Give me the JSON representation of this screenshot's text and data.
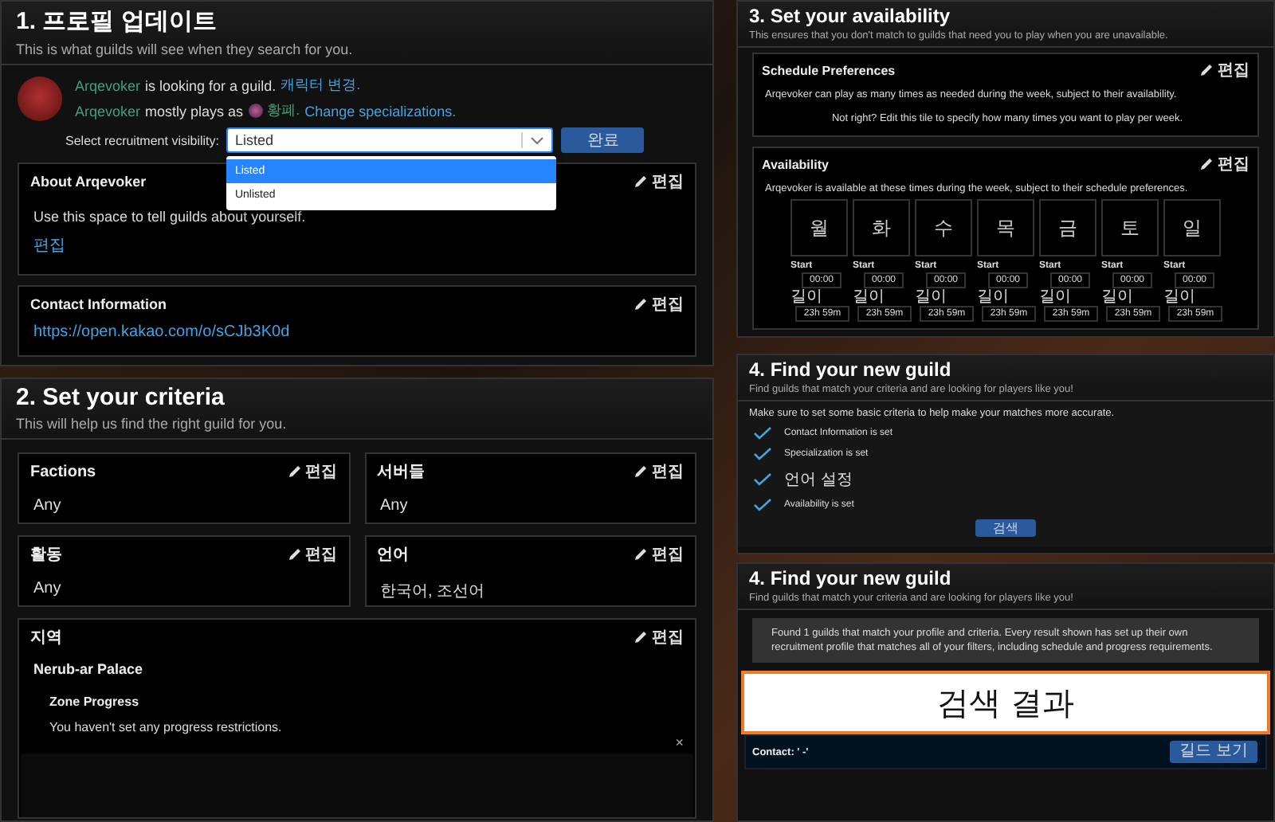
{
  "profile": {
    "title": "1. 프로필 업데이트",
    "subtitle": "This is what guilds will see when they search for you.",
    "lines": [
      {
        "name": "Arqevoker",
        "text": "is looking for a guild.",
        "link": "캐릭터 변경."
      },
      {
        "name": "Arqevoker",
        "text": "mostly plays as",
        "spec": "황폐.",
        "link": "Change specializations."
      }
    ],
    "visibility_label": "Select recruitment visibility:",
    "visibility_value": "Listed",
    "visibility_options": [
      {
        "label": "Listed",
        "selected": true
      },
      {
        "label": "Unlisted",
        "selected": false
      }
    ],
    "done_button": "완료",
    "cards": [
      {
        "title": "About Arqevoker",
        "edit": "편집",
        "text": "Use this space to tell guilds about yourself.",
        "link": "편집"
      },
      {
        "title": "Contact Information",
        "edit": "편집",
        "link": "https://open.kakao.com/o/sCJb3K0d"
      }
    ]
  },
  "criteria": {
    "title": "2. Set your criteria",
    "subtitle": "This will help us find the right guild for you.",
    "cards": [
      {
        "kind": "simple",
        "title": "Factions",
        "edit": "편집",
        "value": "Any"
      },
      {
        "kind": "simple",
        "title": "서버들",
        "edit": "편집",
        "value": "Any"
      },
      {
        "kind": "simple",
        "title": "활동",
        "edit": "편집",
        "value": "Any"
      },
      {
        "kind": "simple",
        "title": "언어",
        "edit": "편집",
        "value": "한국어, 조선어"
      },
      {
        "kind": "zone",
        "title": "지역",
        "edit": "편집",
        "zone": "Nerub-ar Palace",
        "progress_title": "Zone Progress",
        "progress_text": "You haven't set any progress restrictions.",
        "close": "×"
      }
    ]
  },
  "availability": {
    "title": "3. Set your availability",
    "subtitle": "This ensures that you don't match to guilds that need you to play when you are unavailable.",
    "schedule": {
      "title": "Schedule Preferences",
      "edit": "편집",
      "text": "Arqevoker can play as many times as needed during the week, subject to their availability.",
      "link": "Not right? Edit this tile to specify how many times you want to play per week."
    },
    "times": {
      "title": "Availability",
      "edit": "편집",
      "text": "Arqevoker is available at these times during the week, subject to their schedule preferences.",
      "days": [
        {
          "day": "월",
          "start_label": "Start",
          "start": "00:00",
          "length_label": "길이",
          "length": "23h 59m"
        },
        {
          "day": "화",
          "start_label": "Start",
          "start": "00:00",
          "length_label": "길이",
          "length": "23h 59m"
        },
        {
          "day": "수",
          "start_label": "Start",
          "start": "00:00",
          "length_label": "길이",
          "length": "23h 59m"
        },
        {
          "day": "목",
          "start_label": "Start",
          "start": "00:00",
          "length_label": "길이",
          "length": "23h 59m"
        },
        {
          "day": "금",
          "start_label": "Start",
          "start": "00:00",
          "length_label": "길이",
          "length": "23h 59m"
        },
        {
          "day": "토",
          "start_label": "Start",
          "start": "00:00",
          "length_label": "길이",
          "length": "23h 59m"
        },
        {
          "day": "일",
          "start_label": "Start",
          "start": "00:00",
          "length_label": "길이",
          "length": "23h 59m"
        }
      ]
    }
  },
  "find": {
    "title": "4. Find your new guild",
    "subtitle": "Find guilds that match your criteria and are looking for players like you!",
    "intro": "Make sure to set some basic criteria to help make your matches more accurate.",
    "checklist": [
      {
        "label": "Contact Information is set",
        "checked": true
      },
      {
        "label": "Specialization is set",
        "checked": true
      },
      {
        "label": "언어 설정",
        "checked": true
      },
      {
        "label": "Availability is set",
        "checked": true
      }
    ],
    "search_button": "검색"
  },
  "results": {
    "title": "4. Find your new guild",
    "subtitle": "Find guilds that match your criteria and are looking for players like you!",
    "summary": "Found 1 guilds that match your profile and criteria. Every result shown has set up their own recruitment profile that matches all of your filters, including schedule and progress requirements.",
    "result_label": "검색 결과",
    "contact": "Contact: ' -'",
    "view_button": "길드 보기"
  }
}
